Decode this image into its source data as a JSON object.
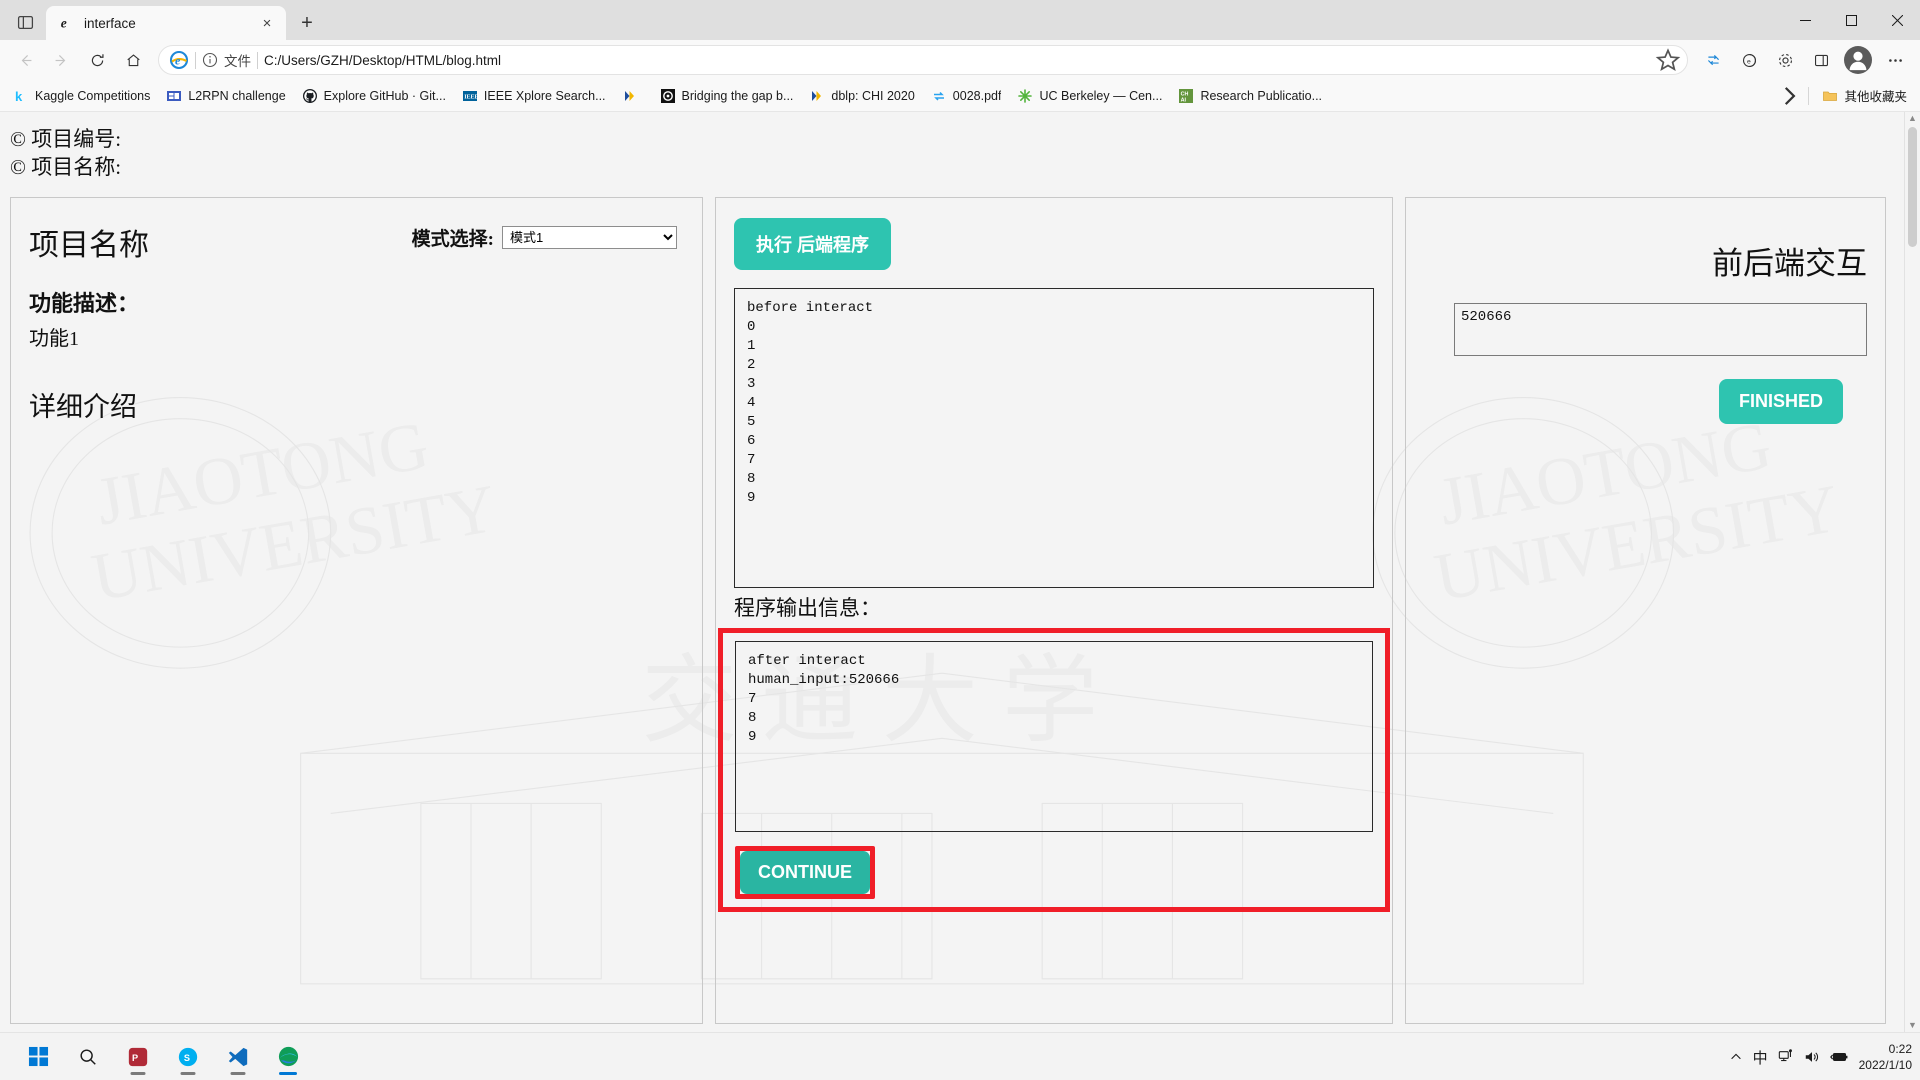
{
  "window": {
    "tab": {
      "title": "interface",
      "favicon": "edge-legacy-icon",
      "close": "×"
    },
    "new_tab": "+",
    "controls": {
      "minimize": "minimize-icon",
      "maximize": "maximize-icon",
      "close": "close-icon"
    }
  },
  "toolbar": {
    "back": "back-arrow-icon",
    "forward": "forward-arrow-icon",
    "refresh": "refresh-icon",
    "home": "home-icon",
    "address": {
      "site_icon": "ie-mode-icon",
      "info_icon": "info-circle-icon",
      "file_label": "文件",
      "url": "C:/Users/GZH/Desktop/HTML/blog.html",
      "star_icon": "favorite-star-icon"
    },
    "right_icons": [
      "collections-icon",
      "browser-essentials-icon",
      "extensions-icon",
      "split-screen-icon"
    ],
    "profile": "profile-avatar",
    "more": "more-options-icon"
  },
  "bookmarks": {
    "items": [
      {
        "label": "Kaggle Competitions",
        "icon": "kaggle-icon"
      },
      {
        "label": "L2RPN challenge",
        "icon": "l2rpn-icon"
      },
      {
        "label": "Explore GitHub · Git...",
        "icon": "github-icon"
      },
      {
        "label": "IEEE Xplore Search...",
        "icon": "ieee-icon"
      },
      {
        "label": "",
        "icon": "bookmark-flag-icon"
      },
      {
        "label": "Bridging the gap b...",
        "icon": "ol-icon"
      },
      {
        "label": "dblp: CHI 2020",
        "icon": "dblp-icon"
      },
      {
        "label": "0028.pdf",
        "icon": "pdf-sync-icon"
      },
      {
        "label": "UC Berkeley — Cen...",
        "icon": "berkeley-icon"
      },
      {
        "label": "Research Publicatio...",
        "icon": "chai-icon"
      }
    ],
    "overflow_icon": "chevron-right-icon",
    "other_folder": {
      "label": "其他收藏夹",
      "icon": "folder-icon"
    }
  },
  "page": {
    "header_lines": [
      "© 项目编号:",
      "© 项目名称:"
    ],
    "left_panel": {
      "project_title": "项目名称",
      "mode_label": "模式选择:",
      "mode_value": "模式1",
      "mode_options": [
        "模式1"
      ],
      "feature_heading": "功能描述：",
      "feature_text": "功能1",
      "detail_heading": "详细介绍"
    },
    "mid_panel": {
      "run_button": "执行 后端程序",
      "console_top": "before interact\n0\n1\n2\n3\n4\n5\n6\n7\n8\n9",
      "output_label": "程序输出信息：",
      "console_bottom": "after interact\nhuman_input:520666\n7\n8\n9",
      "continue_button": "CONTINUE",
      "highlight_color": "#f01e28"
    },
    "right_panel": {
      "title": "前后端交互",
      "input_value": "520666",
      "finished_button": "FINISHED"
    },
    "accent_color": "#2ec4b0"
  },
  "taskbar": {
    "items": [
      {
        "name": "start-button",
        "icon": "windows-logo-icon"
      },
      {
        "name": "search-button",
        "icon": "search-icon"
      },
      {
        "name": "app-pdf",
        "icon": "pdf-app-icon"
      },
      {
        "name": "app-skype",
        "icon": "skype-icon"
      },
      {
        "name": "app-vscode",
        "icon": "vscode-icon"
      },
      {
        "name": "app-edge",
        "icon": "edge-icon"
      }
    ],
    "tray": {
      "overflow": "chevron-up-icon",
      "ime": "中",
      "network": "network-icon",
      "volume": "volume-icon",
      "battery": "battery-charging-icon",
      "time": "0:22",
      "date": "2022/1/10"
    }
  }
}
